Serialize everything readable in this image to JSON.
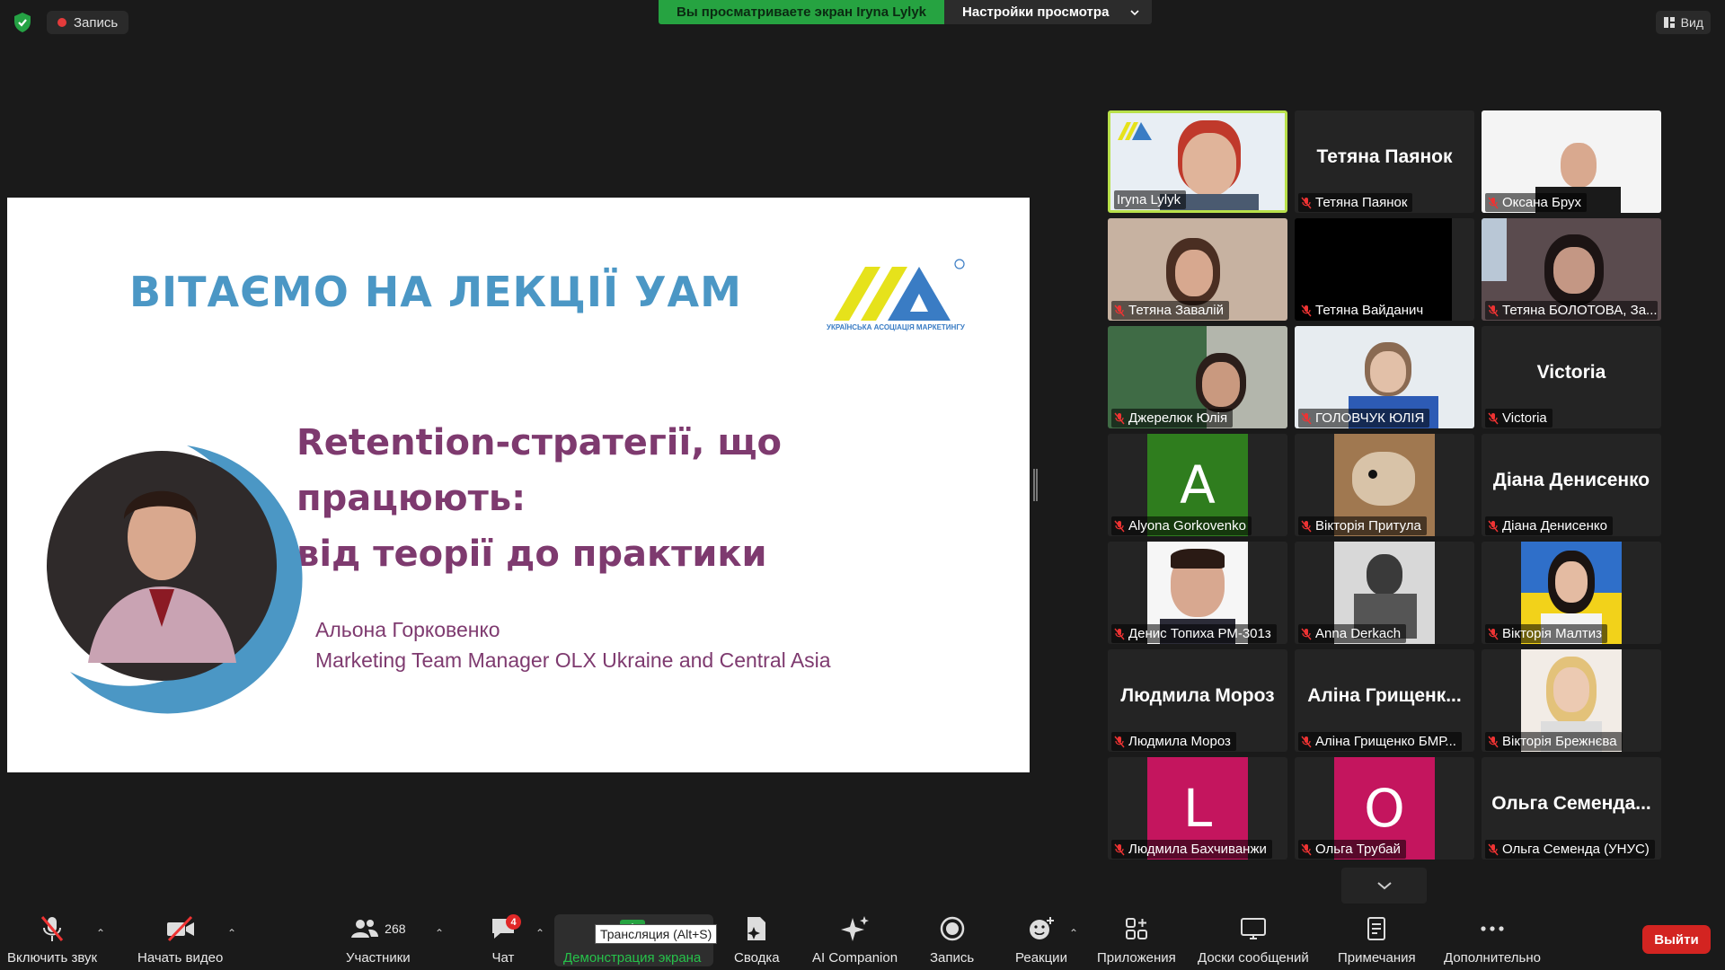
{
  "top": {
    "recording_label": "Запись",
    "share_banner": "Вы просматриваете экран Iryna Lylyk",
    "view_settings": "Настройки просмотра",
    "view_button": "Вид"
  },
  "slide": {
    "title": "ВІТАЄМО НА ЛЕКЦІЇ УАМ",
    "logo_caption": "УКРАЇНСЬКА АСОЦІАЦІЯ МАРКЕТИНГУ",
    "lecture_line1": "Retention-стратегії, що працюють:",
    "lecture_line2": "від теорії до практики",
    "speaker_name": "Альона Горковенко",
    "speaker_role": "Marketing Team Manager OLX Ukraine and Central Asia"
  },
  "gallery": [
    {
      "label": "Iryna Lylyk",
      "type": "video",
      "muted": false,
      "active": true
    },
    {
      "label": "Тетяна Паянок",
      "type": "name",
      "big": "Тетяна Паянок",
      "muted": true
    },
    {
      "label": "Оксана Брух",
      "type": "video",
      "muted": true
    },
    {
      "label": "Тетяна Завалій",
      "type": "video",
      "muted": true
    },
    {
      "label": "Тетяна Вайданич",
      "type": "black",
      "muted": true
    },
    {
      "label": "Тетяна БОЛОТОВА, За...",
      "type": "video",
      "muted": true
    },
    {
      "label": "Джерелюк Юлія",
      "type": "video",
      "muted": true
    },
    {
      "label": "ГОЛОВЧУК ЮЛІЯ",
      "type": "video",
      "muted": true
    },
    {
      "label": "Victoria",
      "type": "name",
      "big": "Victoria",
      "muted": true
    },
    {
      "label": "Alyona Gorkovenko",
      "type": "avatar",
      "letter": "A",
      "color": "#2f7d1e",
      "muted": true
    },
    {
      "label": "Вікторія Притула",
      "type": "video",
      "muted": true
    },
    {
      "label": "Діана Денисенко",
      "type": "name",
      "big": "Діана Денисенко",
      "muted": true
    },
    {
      "label": "Денис Топиха РМ-301з",
      "type": "video",
      "muted": true
    },
    {
      "label": "Anna Derkach",
      "type": "video",
      "muted": true
    },
    {
      "label": "Вікторія Малтиз",
      "type": "video",
      "muted": true
    },
    {
      "label": "Людмила Мороз",
      "type": "name",
      "big": "Людмила Мороз",
      "muted": true
    },
    {
      "label": "Аліна Грищенко БМР...",
      "type": "name",
      "big": "Аліна Грищенк...",
      "muted": true
    },
    {
      "label": "Вікторія Брежнєва",
      "type": "video",
      "muted": true
    },
    {
      "label": "Людмила Бахчиванжи",
      "type": "avatar",
      "letter": "L",
      "color": "#c4155e",
      "muted": true
    },
    {
      "label": "Ольга Трубай",
      "type": "avatar",
      "letter": "O",
      "color": "#c4155e",
      "muted": true
    },
    {
      "label": "Ольга Семенда (УНУС)",
      "type": "name",
      "big": "Ольга  Семенда...",
      "muted": true
    }
  ],
  "toolbar": {
    "unmute": "Включить звук",
    "start_video": "Начать видео",
    "participants": "Участники",
    "participants_count": "268",
    "chat": "Чат",
    "chat_badge": "4",
    "share_screen": "Демонстрация экрана",
    "share_tooltip": "Трансляция (Alt+S)",
    "summary": "Сводка",
    "ai_companion": "AI Companion",
    "record": "Запись",
    "reactions": "Реакции",
    "apps": "Приложения",
    "whiteboards": "Доски сообщений",
    "notes": "Примечания",
    "more": "Дополнительно",
    "leave": "Выйти"
  }
}
